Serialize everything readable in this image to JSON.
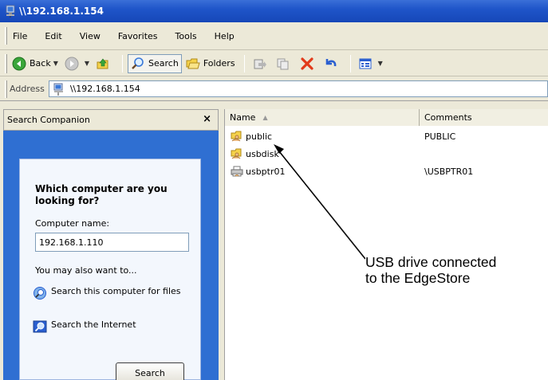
{
  "window": {
    "title": "\\\\192.168.1.154",
    "accent_color": "#1f55c9"
  },
  "menu": {
    "items": [
      {
        "label": "File",
        "icon": null
      },
      {
        "label": "Edit",
        "icon": null
      },
      {
        "label": "View",
        "icon": null
      },
      {
        "label": "Favorites",
        "icon": null
      },
      {
        "label": "Tools",
        "icon": null
      },
      {
        "label": "Help",
        "icon": null
      }
    ]
  },
  "toolbar": {
    "back_label": "Back",
    "search_label": "Search",
    "folders_label": "Folders"
  },
  "address": {
    "label": "Address",
    "value": "\\\\192.168.1.154"
  },
  "search_companion": {
    "title": "Search Companion",
    "close_glyph": "×",
    "heading": "Which computer are you looking for?",
    "computer_name_label": "Computer name:",
    "computer_name_value": "192.168.1.110",
    "also_label": "You may also want to...",
    "link_search_computer": "Search this computer for files",
    "link_search_internet": "Search the Internet",
    "search_button": "Search"
  },
  "file_list": {
    "columns": [
      "Name",
      "Comments"
    ],
    "sort_glyph": "▲",
    "rows": [
      {
        "name": "public",
        "comment": "PUBLIC",
        "icon": "shared-folder-icon"
      },
      {
        "name": "usbdisk",
        "comment": "",
        "icon": "shared-folder-icon"
      },
      {
        "name": "usbptr01",
        "comment": "\\USBPTR01",
        "icon": "printer-icon"
      }
    ]
  },
  "annotation": {
    "line1": "USB drive connected",
    "line2": "to the EdgeStore"
  }
}
